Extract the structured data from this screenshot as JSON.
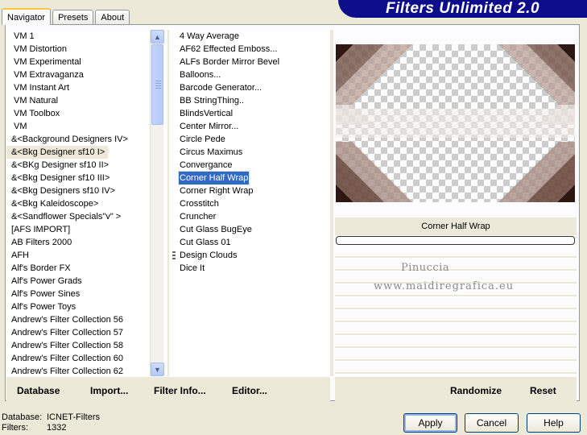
{
  "tabs": [
    "Navigator",
    "Presets",
    "About"
  ],
  "banner": "Filters Unlimited 2.0",
  "categories": [
    "VM 1",
    "VM Distortion",
    "VM Experimental",
    "VM Extravaganza",
    "VM Instant Art",
    "VM Natural",
    "VM Toolbox",
    "VM",
    "&<Background Designers IV>",
    "&<Bkg Designer sf10 I>",
    "&<BKg Designer sf10 II>",
    "&<Bkg Designer sf10 III>",
    "&<Bkg Designers sf10 IV>",
    "&<Bkg Kaleidoscope>",
    "&<Sandflower Specials\"v\" >",
    "[AFS IMPORT]",
    "AB Filters 2000",
    "AFH",
    "Alf's Border FX",
    "Alf's Power Grads",
    "Alf's Power Sines",
    "Alf's Power Toys",
    "Andrew's Filter Collection 56",
    "Andrew's Filter Collection 57",
    "Andrew's Filter Collection 58",
    "Andrew's Filter Collection 60",
    "Andrew's Filter Collection 62"
  ],
  "selected_category": "&<Bkg Designer sf10 I>",
  "filters": [
    "4 Way Average",
    "AF62 Effected Emboss...",
    "ALFs Border Mirror Bevel",
    "Balloons...",
    "Barcode Generator...",
    "BB StringThing..",
    "BlindsVertical",
    "Center Mirror...",
    "Circle Pede",
    "Circus Maximus",
    "Convergance",
    "Corner Half Wrap",
    "Corner Right Wrap",
    "Crosstitch",
    "Cruncher",
    "Cut Glass  BugEye",
    "Cut Glass 01",
    "Design Clouds",
    "Dice It"
  ],
  "selected_filter": "Corner Half Wrap",
  "filter_name": "Corner Half Wrap",
  "watermark": {
    "line1": "Pinuccia",
    "line2": "www.maidiregrafica.eu"
  },
  "panel_buttons": {
    "database": "Database",
    "import": "Import...",
    "filter_info": "Filter Info...",
    "editor": "Editor...",
    "randomize": "Randomize",
    "reset": "Reset"
  },
  "status": {
    "database_label": "Database:",
    "database_value": "ICNET-Filters",
    "filters_label": "Filters:",
    "filters_value": "1332"
  },
  "dialog_buttons": {
    "apply": "Apply",
    "cancel": "Cancel",
    "help": "Help"
  },
  "colors": {
    "banner": "#0d0d8c",
    "selection": "#316ac5",
    "preview_dark": "#2d1710",
    "preview_mid": "#8b6a5d"
  }
}
